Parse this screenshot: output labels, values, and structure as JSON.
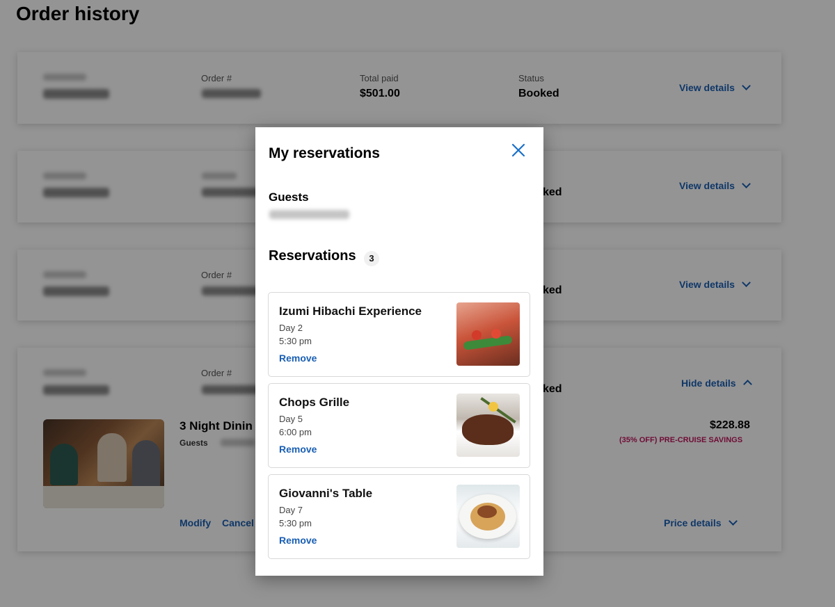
{
  "page": {
    "title": "Order history"
  },
  "orders": [
    {
      "order_label": "Order #",
      "total_label": "Total paid",
      "total_value": "$501.00",
      "status_label": "Status",
      "status_value": "Booked",
      "toggle_label": "View details"
    },
    {
      "status_value": "ked",
      "toggle_label": "View details"
    },
    {
      "order_label": "Order #",
      "status_value": "ked",
      "toggle_label": "View details"
    },
    {
      "order_label": "Order #",
      "status_value": "ked",
      "toggle_label": "Hide details",
      "item": {
        "title": "3 Night Dinin",
        "guests_label": "Guests",
        "price": "$228.88",
        "savings": "(35% OFF) PRE-CRUISE SAVINGS",
        "modify_label": "Modify",
        "cancel_label": "Cancel",
        "price_details_label": "Price details"
      }
    }
  ],
  "modal": {
    "title": "My reservations",
    "close_icon": "close-icon",
    "guests_heading": "Guests",
    "reservations_heading": "Reservations",
    "reservations_count": "3",
    "reservations": [
      {
        "name": "Izumi Hibachi Experience",
        "day": "Day 2",
        "time": "5:30 pm",
        "remove_label": "Remove"
      },
      {
        "name": "Chops Grille",
        "day": "Day 5",
        "time": "6:00 pm",
        "remove_label": "Remove"
      },
      {
        "name": "Giovanni's Table",
        "day": "Day 7",
        "time": "5:30 pm",
        "remove_label": "Remove"
      }
    ]
  },
  "colors": {
    "link": "#1a5fb4",
    "savings": "#c0185e",
    "close": "#1a6fc9"
  }
}
